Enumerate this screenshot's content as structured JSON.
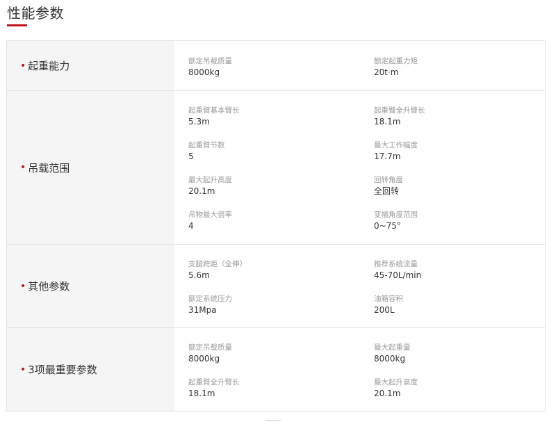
{
  "page": {
    "title": "性能参数"
  },
  "sections": [
    {
      "label": "起重能力",
      "fields": [
        {
          "label": "额定吊载质量",
          "value": "8000kg"
        },
        {
          "label": "额定起重力矩",
          "value": "20t·m"
        }
      ]
    },
    {
      "label": "吊载范围",
      "fields": [
        {
          "label": "起重臂基本臂长",
          "value": "5.3m"
        },
        {
          "label": "起重臂全升臂长",
          "value": "18.1m"
        },
        {
          "label": "起重臂节数",
          "value": "5"
        },
        {
          "label": "最大工作幅度",
          "value": "17.7m"
        },
        {
          "label": "最大起升高度",
          "value": "20.1m"
        },
        {
          "label": "回转角度",
          "value": "全回转"
        },
        {
          "label": "吊物最大倍率",
          "value": "4"
        },
        {
          "label": "变幅角度范围",
          "value": "0~75°"
        }
      ]
    },
    {
      "label": "其他参数",
      "fields": [
        {
          "label": "支腿跨距（全伸）",
          "value": "5.6m"
        },
        {
          "label": "推荐系统流量",
          "value": "45-70L/min"
        },
        {
          "label": "额定系统压力",
          "value": "31Mpa"
        },
        {
          "label": "油箱容积",
          "value": "200L"
        }
      ]
    },
    {
      "label": "3项最重要参数",
      "fields": [
        {
          "label": "额定吊载质量",
          "value": "8000kg"
        },
        {
          "label": "最大起重量",
          "value": "8000kg"
        },
        {
          "label": "起重臂全升臂长",
          "value": "18.1m"
        },
        {
          "label": "最大起升高度",
          "value": "20.1m"
        }
      ]
    }
  ]
}
